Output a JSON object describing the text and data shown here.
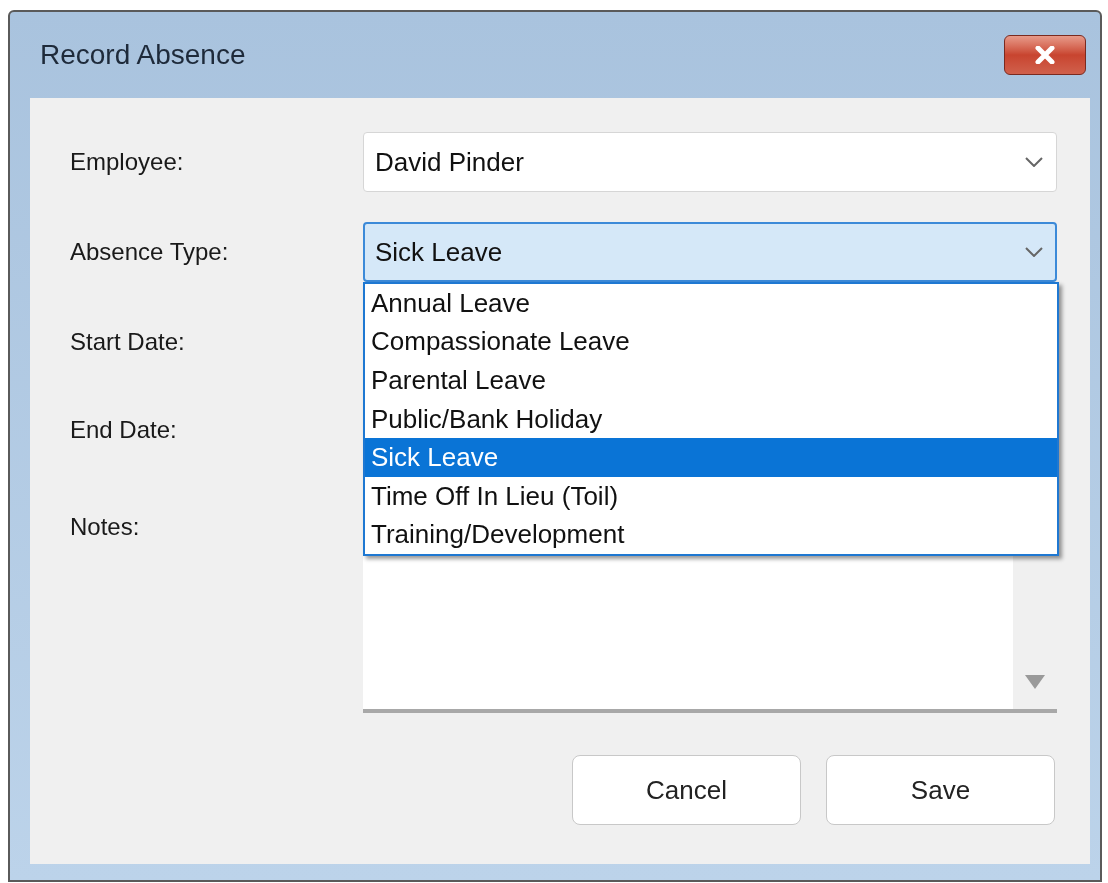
{
  "window": {
    "title": "Record Absence"
  },
  "fields": [
    {
      "label": "Employee:",
      "kind": "combo",
      "value": "David Pinder",
      "focused": false
    },
    {
      "label": "Absence Type:",
      "kind": "combo",
      "value": "Sick Leave",
      "focused": true
    },
    {
      "label": "Start Date:",
      "kind": "date"
    },
    {
      "label": "End Date:",
      "kind": "date"
    },
    {
      "label": "Notes:",
      "kind": "notes"
    }
  ],
  "dropdown": {
    "items": [
      {
        "label": "Annual Leave",
        "selected": false
      },
      {
        "label": "Compassionate Leave",
        "selected": false
      },
      {
        "label": "Parental Leave",
        "selected": false
      },
      {
        "label": "Public/Bank Holiday",
        "selected": false
      },
      {
        "label": "Sick Leave",
        "selected": true
      },
      {
        "label": "Time Off In Lieu (Toil)",
        "selected": false
      },
      {
        "label": "Training/Development",
        "selected": false
      }
    ]
  },
  "buttons": [
    "Cancel",
    "Save"
  ]
}
